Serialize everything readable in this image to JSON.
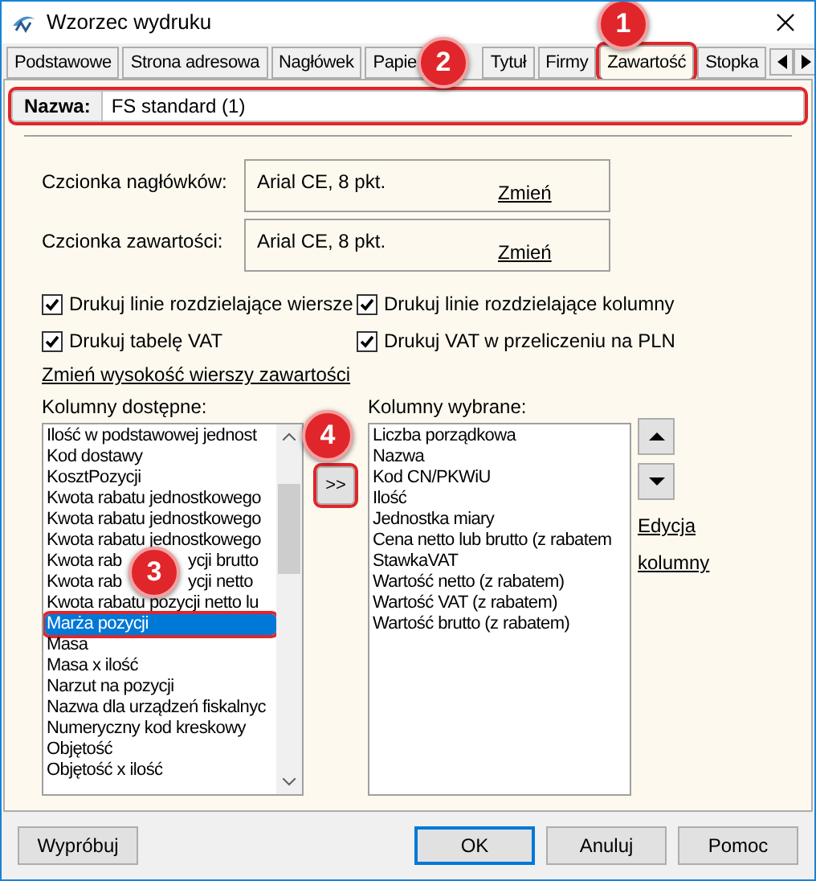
{
  "window": {
    "title": "Wzorzec wydruku"
  },
  "tabs": [
    {
      "label": "Podstawowe",
      "selected": false,
      "highlighted": false
    },
    {
      "label": "Strona adresowa",
      "selected": false,
      "highlighted": false
    },
    {
      "label": "Nagłówek",
      "selected": false,
      "highlighted": false
    },
    {
      "label": "Papie",
      "kind": "covered",
      "selected": false,
      "highlighted": false
    },
    {
      "label": "Tytuł",
      "selected": false,
      "highlighted": false
    },
    {
      "label": "Firmy",
      "selected": false,
      "highlighted": false
    },
    {
      "label": "Zawartość",
      "selected": true,
      "highlighted": true
    },
    {
      "label": "Stopka",
      "selected": false,
      "highlighted": false
    }
  ],
  "name_field": {
    "label": "Nazwa:",
    "value": "FS standard (1)",
    "highlighted": true
  },
  "fonts": [
    {
      "label": "Czcionka nagłówków:",
      "value": "Arial CE, 8 pkt.",
      "link": "Zmień"
    },
    {
      "label": "Czcionka zawartości:",
      "value": "Arial CE, 8 pkt.",
      "link": "Zmień"
    }
  ],
  "options": [
    {
      "label": "Drukuj linie rozdzielające wiersze",
      "checked": true
    },
    {
      "label": "Drukuj linie rozdzielające kolumny",
      "checked": true
    },
    {
      "label": "Drukuj tabelę VAT",
      "checked": true
    },
    {
      "label": "Drukuj VAT w przeliczeniu na PLN",
      "checked": true
    }
  ],
  "row_height_link": "Zmień wysokość wierszy zawartości",
  "available": {
    "label": "Kolumny dostępne:",
    "items": [
      {
        "text": "Ilość w podstawowej jednost",
        "selected": false,
        "highlighted": false
      },
      {
        "text": "Kod dostawy",
        "selected": false,
        "highlighted": false
      },
      {
        "text": "KosztPozycji",
        "selected": false,
        "highlighted": false
      },
      {
        "text": "Kwota rabatu jednostkowego",
        "selected": false,
        "highlighted": false
      },
      {
        "text": "Kwota rabatu jednostkowego",
        "selected": false,
        "highlighted": false
      },
      {
        "text": "Kwota rabatu jednostkowego",
        "selected": false,
        "highlighted": false
      },
      {
        "kind": "covered",
        "parts": [
          "Kwota rab",
          "ycji brutto"
        ],
        "selected": false,
        "highlighted": false
      },
      {
        "kind": "covered",
        "parts": [
          "Kwota rab",
          "ycji netto"
        ],
        "selected": false,
        "highlighted": false
      },
      {
        "text": "Kwota rabatu pozycji netto lu",
        "selected": false,
        "highlighted": false
      },
      {
        "text": "Marża pozycji",
        "selected": true,
        "highlighted": true
      },
      {
        "text": "Masa",
        "selected": false,
        "highlighted": false
      },
      {
        "text": "Masa x ilość",
        "selected": false,
        "highlighted": false
      },
      {
        "text": "Narzut na pozycji",
        "selected": false,
        "highlighted": false
      },
      {
        "text": "Nazwa dla urządzeń fiskalnyc",
        "selected": false,
        "highlighted": false
      },
      {
        "text": "Numeryczny kod kreskowy",
        "selected": false,
        "highlighted": false
      },
      {
        "text": "Objętość",
        "selected": false,
        "highlighted": false
      },
      {
        "text": "Objętość x ilość",
        "selected": false,
        "highlighted": false
      }
    ]
  },
  "add_button": {
    "label": ">>",
    "highlighted": true
  },
  "chosen": {
    "label": "Kolumny wybrane:",
    "items": [
      "Liczba porządkowa",
      "Nazwa",
      "Kod CN/PKWiU",
      "Ilość",
      "Jednostka miary",
      "Cena netto lub brutto (z rabatem",
      "StawkaVAT",
      "Wartość netto (z rabatem)",
      "Wartość VAT (z rabatem)",
      "Wartość brutto (z rabatem)"
    ]
  },
  "edit_link": [
    "Edycja",
    "kolumny"
  ],
  "buttons": [
    {
      "label": "Wypróbuj",
      "default": false
    },
    {
      "label": "OK",
      "default": true
    },
    {
      "label": "Anuluj",
      "default": false
    },
    {
      "label": "Pomoc",
      "default": false
    }
  ],
  "callouts": [
    {
      "number": "1"
    },
    {
      "number": "2"
    },
    {
      "number": "3"
    },
    {
      "number": "4"
    }
  ]
}
